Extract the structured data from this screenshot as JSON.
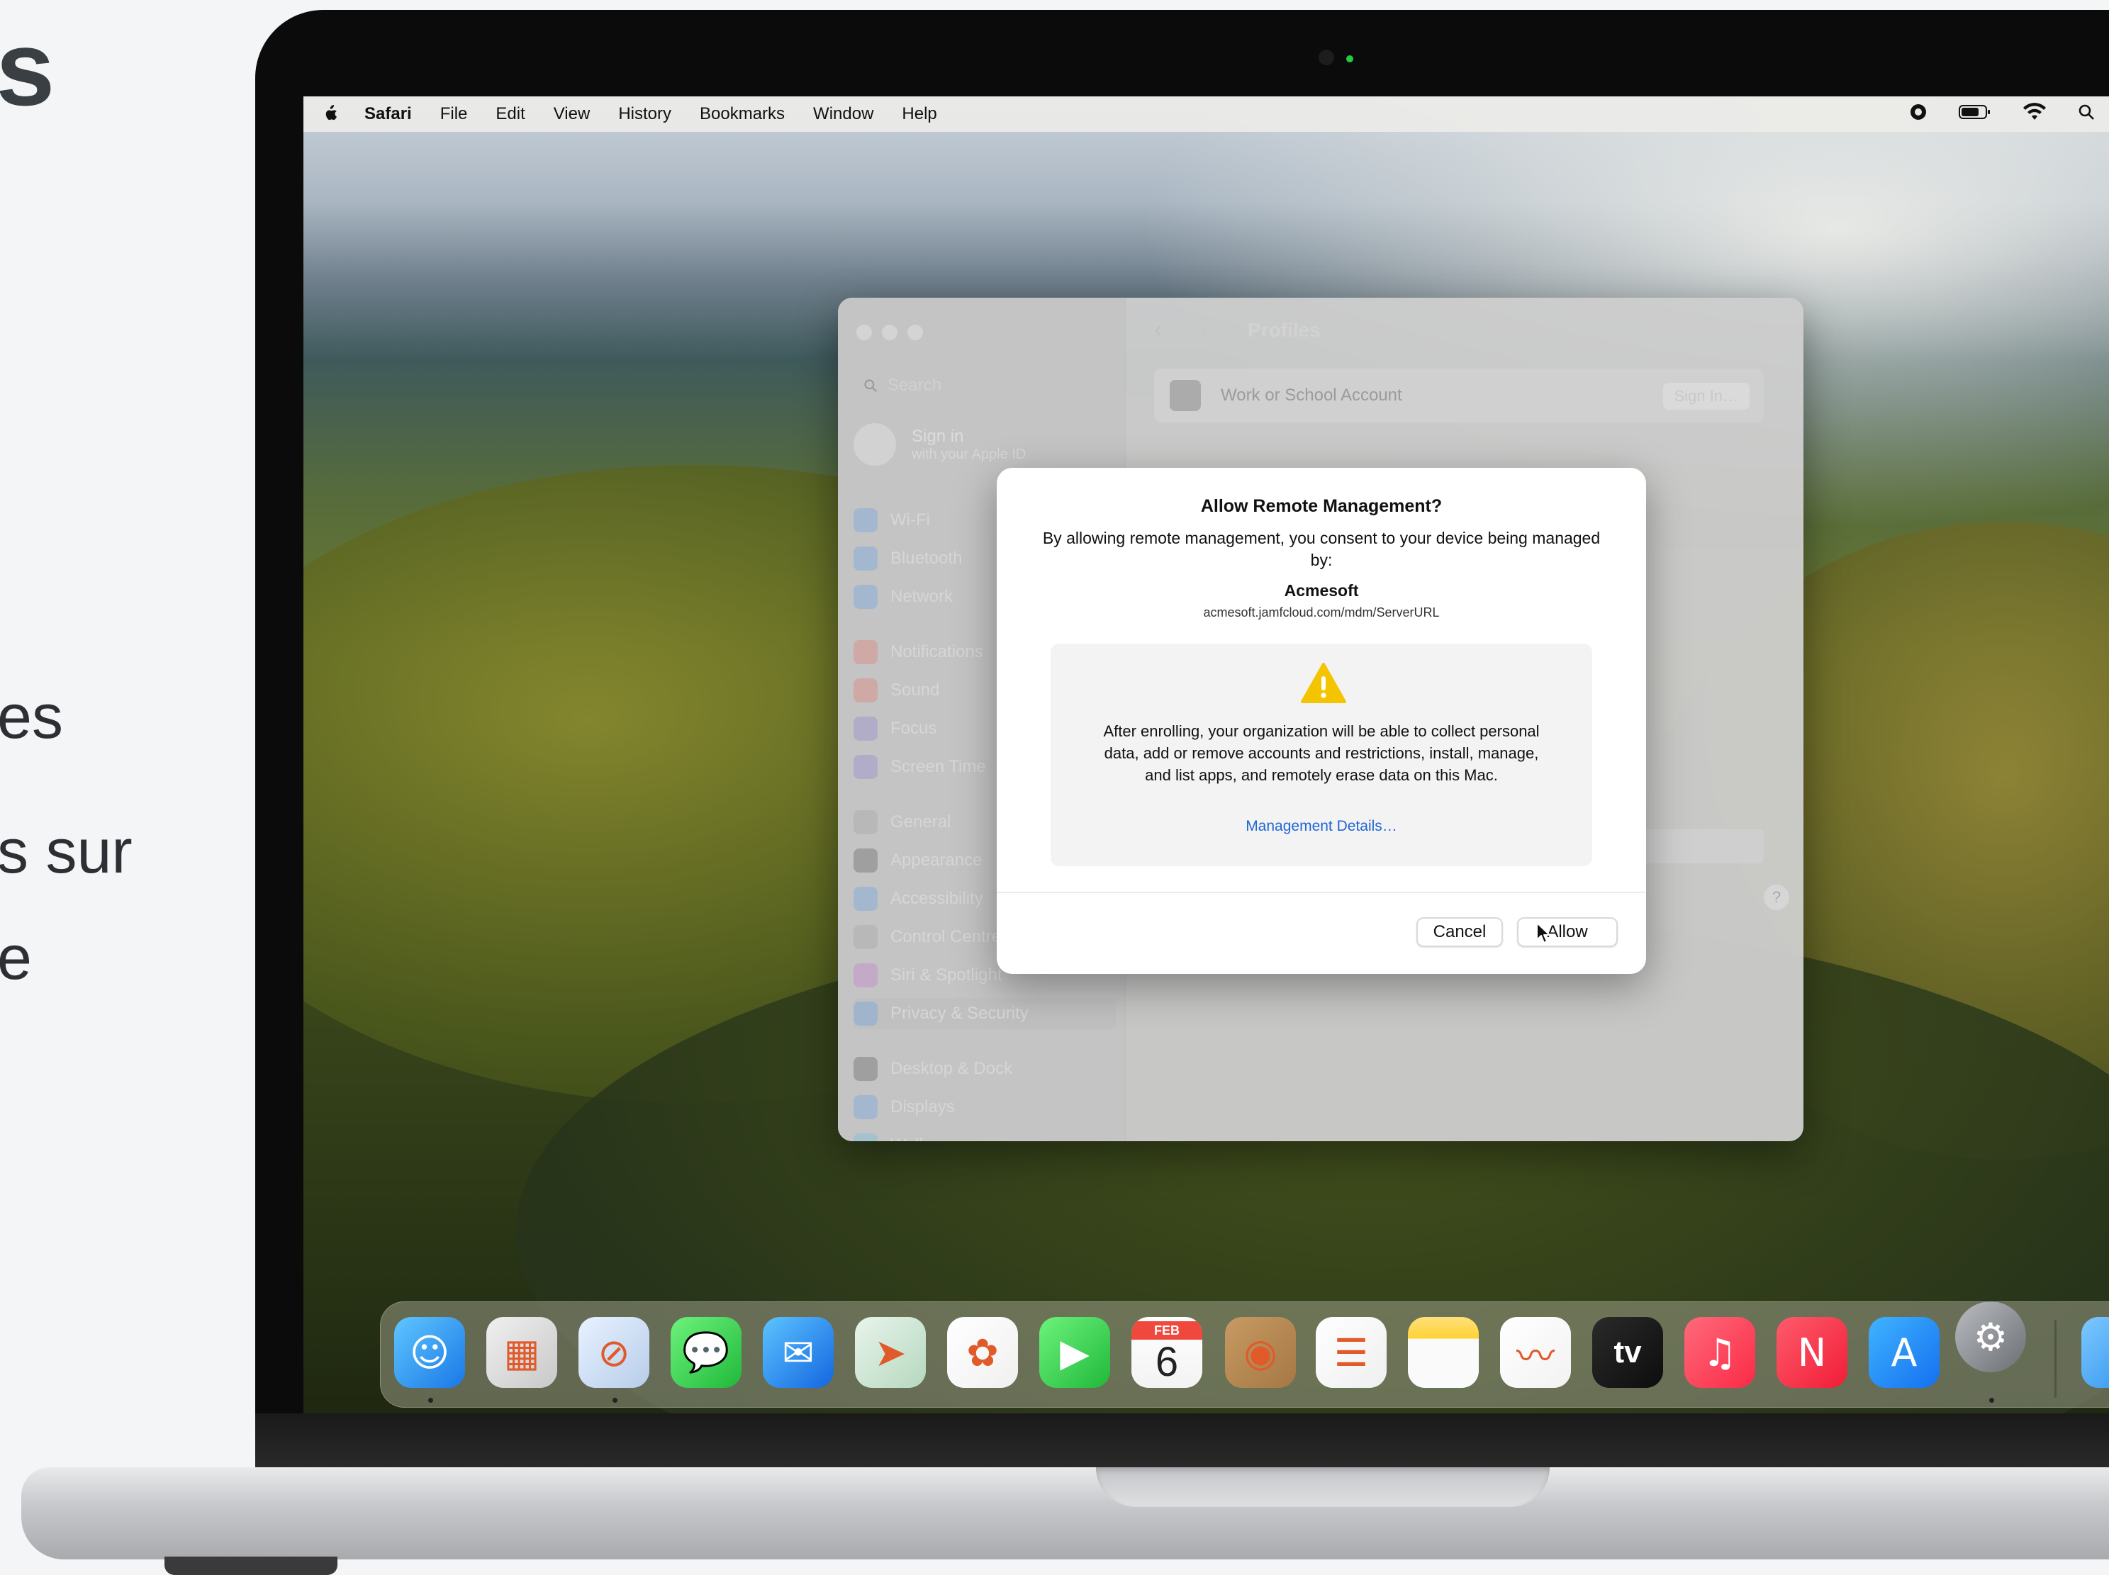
{
  "page": {
    "heading_fragment": "s",
    "text_fragments": [
      "es",
      "s sur",
      "e"
    ]
  },
  "menubar": {
    "app": "Safari",
    "items": [
      "File",
      "Edit",
      "View",
      "History",
      "Bookmarks",
      "Window",
      "Help"
    ],
    "status_icons": [
      "screen-record-icon",
      "battery-icon",
      "wifi-icon",
      "search-icon"
    ]
  },
  "settings": {
    "search_placeholder": "Search",
    "apple_id": {
      "line1": "Sign in",
      "line2": "with your Apple ID"
    },
    "sidebar_items": [
      {
        "label": "Wi-Fi",
        "icon": "wifi-icon",
        "color": "#2f8ff0"
      },
      {
        "label": "Bluetooth",
        "icon": "bluetooth-icon",
        "color": "#2f8ff0"
      },
      {
        "label": "Network",
        "icon": "network-icon",
        "color": "#2f8ff0"
      },
      {
        "label": "Notifications",
        "icon": "bell-icon",
        "color": "#f0483c"
      },
      {
        "label": "Sound",
        "icon": "speaker-icon",
        "color": "#f0483c"
      },
      {
        "label": "Focus",
        "icon": "moon-icon",
        "color": "#6e5ad8"
      },
      {
        "label": "Screen Time",
        "icon": "hourglass-icon",
        "color": "#6e5ad8"
      },
      {
        "label": "General",
        "icon": "gear-icon",
        "color": "#8e8e93"
      },
      {
        "label": "Appearance",
        "icon": "appearance-icon",
        "color": "#1c1c1e"
      },
      {
        "label": "Accessibility",
        "icon": "accessibility-icon",
        "color": "#2f8ff0"
      },
      {
        "label": "Control Centre",
        "icon": "control-centre-icon",
        "color": "#8e8e93"
      },
      {
        "label": "Siri & Spotlight",
        "icon": "siri-icon",
        "color": "#c24adb"
      },
      {
        "label": "Privacy & Security",
        "icon": "hand-icon",
        "color": "#2f8ff0"
      },
      {
        "label": "Desktop & Dock",
        "icon": "dock-icon",
        "color": "#1c1c1e"
      },
      {
        "label": "Displays",
        "icon": "display-icon",
        "color": "#2f8ff0"
      },
      {
        "label": "Wallpaper",
        "icon": "wallpaper-icon",
        "color": "#34b7f1"
      }
    ],
    "selected_index": 12,
    "pane_title": "Profiles",
    "work_account_label": "Work or School Account",
    "sign_in_button": "Sign In…",
    "help": "?"
  },
  "dialog": {
    "title": "Allow Remote Management?",
    "body": "By allowing remote management, you consent to your device being managed by:",
    "org_name": "Acmesoft",
    "org_url": "acmesoft.jamfcloud.com/mdm/ServerURL",
    "warning": "After enrolling, your organization will be able to collect personal data, add or remove accounts and restrictions, install, manage, and list apps, and remotely erase data on this Mac.",
    "details_link": "Management Details…",
    "cancel": "Cancel",
    "allow": "Allow",
    "accent_color": "#2166d6",
    "warning_color": "#f5c400"
  },
  "dock": {
    "apps": [
      {
        "name": "Finder",
        "icon": "finder-icon",
        "running": true
      },
      {
        "name": "Launchpad",
        "icon": "launchpad-icon",
        "running": false
      },
      {
        "name": "Safari",
        "icon": "safari-icon",
        "running": true
      },
      {
        "name": "Messages",
        "icon": "messages-icon",
        "running": false
      },
      {
        "name": "Mail",
        "icon": "mail-icon",
        "running": false
      },
      {
        "name": "Maps",
        "icon": "maps-icon",
        "running": false
      },
      {
        "name": "Photos",
        "icon": "photos-icon",
        "running": false
      },
      {
        "name": "FaceTime",
        "icon": "facetime-icon",
        "running": false
      },
      {
        "name": "Calendar",
        "icon": "calendar-icon",
        "running": false
      },
      {
        "name": "Contacts",
        "icon": "contacts-icon",
        "running": false
      },
      {
        "name": "Reminders",
        "icon": "reminders-icon",
        "running": false
      },
      {
        "name": "Notes",
        "icon": "notes-icon",
        "running": false
      },
      {
        "name": "Freeform",
        "icon": "freeform-icon",
        "running": false
      },
      {
        "name": "TV",
        "icon": "tv-icon",
        "running": false
      },
      {
        "name": "Music",
        "icon": "music-icon",
        "running": false
      },
      {
        "name": "News",
        "icon": "news-icon",
        "running": false
      },
      {
        "name": "App Store",
        "icon": "app-store-icon",
        "running": false
      },
      {
        "name": "System Settings",
        "icon": "system-settings-icon",
        "running": true
      },
      {
        "name": "Downloads",
        "icon": "folder-icon",
        "running": false
      }
    ],
    "calendar": {
      "month": "FEB",
      "day": "6"
    },
    "tv_label": "tv"
  }
}
